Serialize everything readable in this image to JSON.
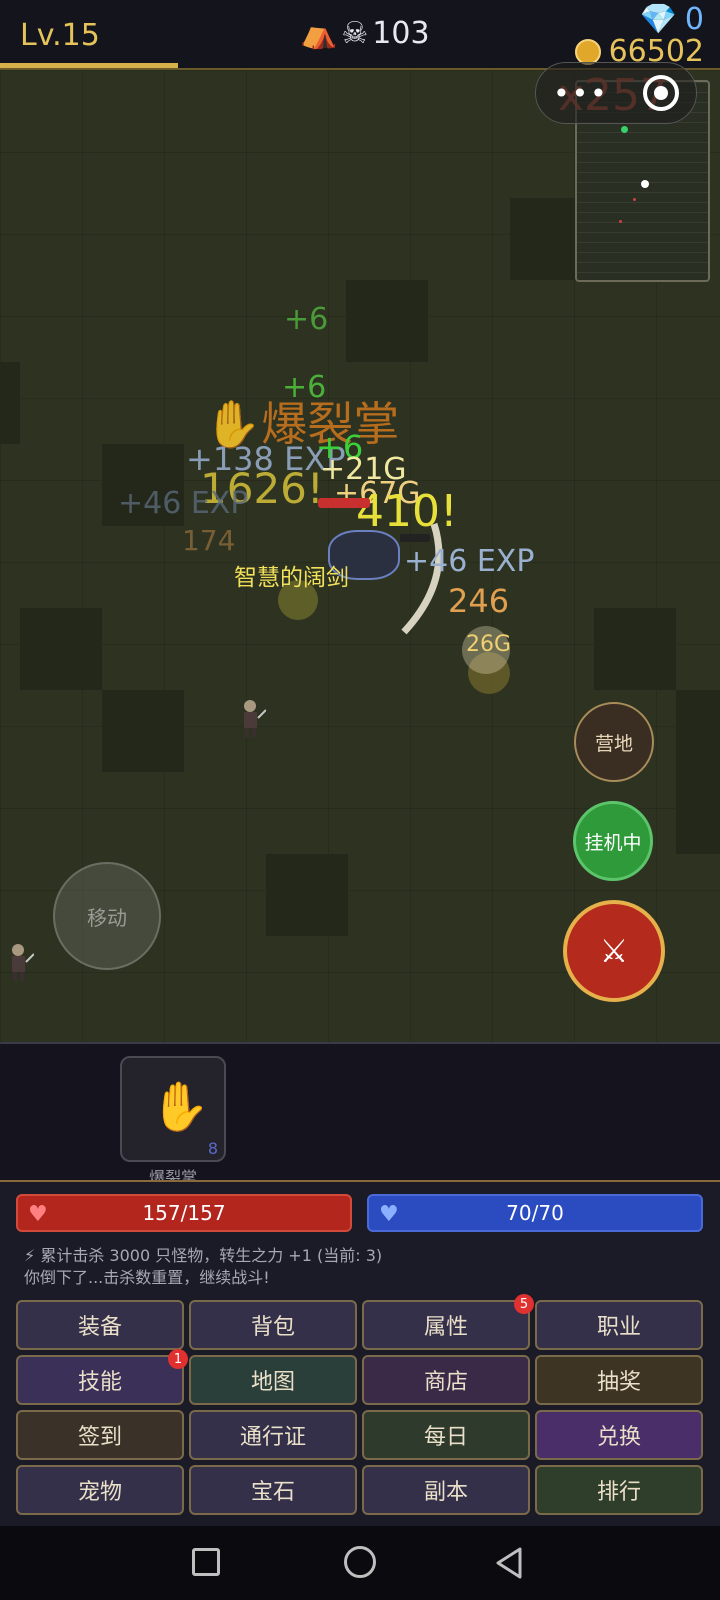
{
  "topbar": {
    "level": "Lv.15",
    "kills": "103",
    "diamonds": "0",
    "gold": "66502"
  },
  "capsule": {
    "overlay_text": "x257",
    "menu_icon": "•••",
    "target_icon": "target-icon"
  },
  "floating_text": {
    "plus6_a": "+6",
    "plus6_b": "+6",
    "plus6_c": "+6",
    "skill_banner": "爆裂掌",
    "exp_138": "+138 EXP",
    "dmg_1626": "1626!",
    "gold_21": "+21G",
    "gold_67": "+67G",
    "dmg_410": "410!",
    "exp_46_left": "+46 EXP",
    "num_174": "174",
    "item_drop": "智慧的阔剑",
    "exp_46_right": "+46 EXP",
    "num_246": "246",
    "gold_26": "26G"
  },
  "controls": {
    "move": "移动",
    "camp": "营地",
    "auto": "挂机中",
    "attack_icon": "crossed-swords-icon"
  },
  "skill": {
    "name": "爆裂掌",
    "count": "8",
    "icon": "hand-icon"
  },
  "stats": {
    "hp": "157/157",
    "mp": "70/70"
  },
  "messages": [
    "⚡ 累计击杀 3000 只怪物，转生之力 +1 (当前: 3)",
    "你倒下了...击杀数重置，继续战斗!"
  ],
  "menu": [
    {
      "label": "装备",
      "bg": "#34304a",
      "badge": ""
    },
    {
      "label": "背包",
      "bg": "#34304a",
      "badge": ""
    },
    {
      "label": "属性",
      "bg": "#34304a",
      "badge": "5"
    },
    {
      "label": "职业",
      "bg": "#34304a",
      "badge": ""
    },
    {
      "label": "技能",
      "bg": "#3a3058",
      "badge": "1"
    },
    {
      "label": "地图",
      "bg": "#2a3e3a",
      "badge": ""
    },
    {
      "label": "商店",
      "bg": "#3a2a48",
      "badge": ""
    },
    {
      "label": "抽奖",
      "bg": "#3e3424",
      "badge": ""
    },
    {
      "label": "签到",
      "bg": "#3a3228",
      "badge": ""
    },
    {
      "label": "通行证",
      "bg": "#34304a",
      "badge": ""
    },
    {
      "label": "每日",
      "bg": "#2e3a2c",
      "badge": ""
    },
    {
      "label": "兑换",
      "bg": "#4a2e6a",
      "badge": ""
    },
    {
      "label": "宠物",
      "bg": "#34304a",
      "badge": ""
    },
    {
      "label": "宝石",
      "bg": "#34304a",
      "badge": ""
    },
    {
      "label": "副本",
      "bg": "#34304a",
      "badge": ""
    },
    {
      "label": "排行",
      "bg": "#2e3e2a",
      "badge": ""
    }
  ]
}
